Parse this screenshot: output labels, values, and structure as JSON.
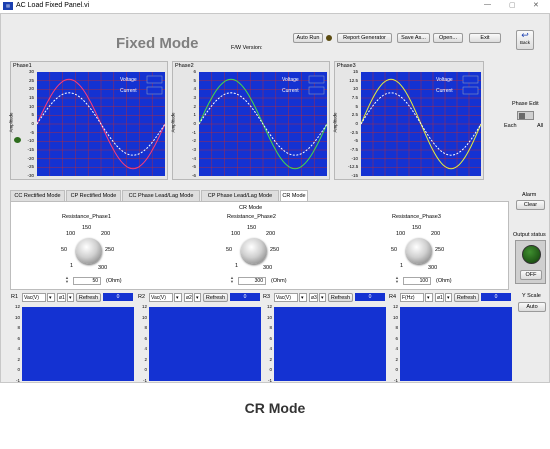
{
  "window": {
    "title": "AC Load Fixed Panel.vi",
    "minimize": "—",
    "maximize": "▢",
    "close": "✕"
  },
  "header": {
    "title": "Fixed Mode",
    "fw_label": "F/W Version:",
    "auto_run": "Auto Run",
    "report_generator": "Report Generator",
    "save_as": "Save As...",
    "open": "Open...",
    "exit": "Exit",
    "back": "Back"
  },
  "graphs": [
    {
      "title": "Phase1",
      "ylabel": "Amplitude",
      "yticks": [
        "30",
        "25",
        "20",
        "15",
        "10",
        "5",
        "0",
        "-5",
        "-10",
        "-15",
        "-20",
        "-25",
        "-30"
      ],
      "legend": [
        "Voltage",
        "Current"
      ],
      "voltage_color": "#ff3c78"
    },
    {
      "title": "Phase2",
      "ylabel": "Amplitude",
      "yticks": [
        "6",
        "5",
        "4",
        "3",
        "2",
        "1",
        "0",
        "-1",
        "-2",
        "-3",
        "-4",
        "-5",
        "-6"
      ],
      "legend": [
        "Voltage",
        "Current"
      ],
      "voltage_color": "#46dc46"
    },
    {
      "title": "Phase3",
      "ylabel": "Amplitude",
      "yticks": [
        "15",
        "12.5",
        "10",
        "7.5",
        "5",
        "2.5",
        "0",
        "-2.5",
        "-5",
        "-7.5",
        "-10",
        "-12.5",
        "-15"
      ],
      "legend": [
        "Voltage",
        "Current"
      ],
      "voltage_color": "#e6f03c"
    }
  ],
  "phase_edit": {
    "label": "Phase Edit",
    "each": "Each",
    "all": "All"
  },
  "tabs": [
    "CC Rectified Mode",
    "CP Rectified Mode",
    "CC Phase Lead/Lag Mode",
    "CP Phase Lead/Lag Mode",
    "CR Mode"
  ],
  "cr_mode": {
    "label": "CR Mode",
    "knobs": [
      {
        "label": "Resistance_Phase1",
        "value": "50",
        "unit": "(Ohm)"
      },
      {
        "label": "Resistance_Phase2",
        "value": "300",
        "unit": "(Ohm)"
      },
      {
        "label": "Resistance_Phase3",
        "value": "100",
        "unit": "(Ohm)"
      }
    ],
    "knob_ticks": {
      "t100": "100",
      "t150": "150",
      "t200": "200",
      "t50": "50",
      "t250": "250",
      "t1": "1",
      "t300": "300"
    }
  },
  "alarm": {
    "label": "Alarm",
    "clear": "Clear"
  },
  "output_status": {
    "label": "Output status",
    "off": "OFF"
  },
  "yscale": {
    "label": "Y Scale",
    "auto": "Auto"
  },
  "scopes": [
    {
      "row": "R1",
      "measure": "Vac(V)",
      "channel": "ø1",
      "refresh": "Refresh",
      "value": "0"
    },
    {
      "row": "R2",
      "measure": "Vac(V)",
      "channel": "ø2",
      "refresh": "Refresh",
      "value": "0"
    },
    {
      "row": "R3",
      "measure": "Vac(V)",
      "channel": "ø3",
      "refresh": "Refresh",
      "value": "0"
    },
    {
      "row": "R4",
      "measure": "F(Hz)",
      "channel": "ø1",
      "refresh": "Refresh",
      "value": "0"
    }
  ],
  "scope_yticks": [
    "12",
    "10",
    "8",
    "6",
    "4",
    "2",
    "0",
    "-1"
  ],
  "caption": "CR Mode",
  "colors": {
    "plot_bg": "#1432d2",
    "current": "#ffffff",
    "grid": "#c82828"
  }
}
